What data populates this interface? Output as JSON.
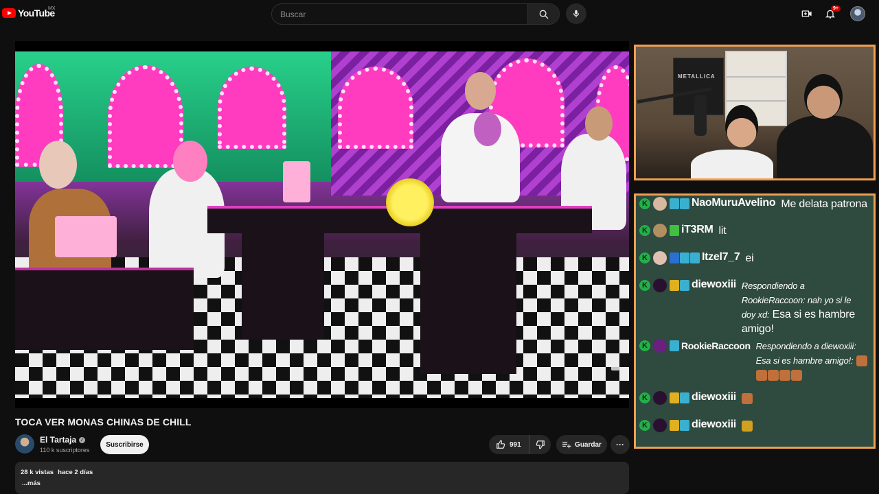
{
  "header": {
    "brand": "YouTube",
    "country": "MX",
    "search_placeholder": "Buscar",
    "notifications_count": "9+"
  },
  "video": {
    "title": "TOCA VER MONAS CHINAS DE CHILL"
  },
  "channel": {
    "name": "El Tartaja",
    "subscribers": "110 k suscriptores",
    "subscribe_label": "Suscribirse"
  },
  "actions": {
    "likes": "991",
    "save_label": "Guardar",
    "more_label": "···"
  },
  "description": {
    "views": "28 k vistas",
    "date": "hace 2 días",
    "more": "...más"
  },
  "webcam": {
    "poster_text": "METALLICA"
  },
  "chat": {
    "messages": [
      {
        "user": "NaoMuruAvelino",
        "text": "Me delata patrona"
      },
      {
        "user": "iT3RM",
        "text": "lit"
      },
      {
        "user": "Itzel7_7",
        "text": "ei"
      },
      {
        "user": "diewoxiii",
        "reply": "Respondiendo a RookieRaccoon: nah yo si le doy xd:",
        "text": "Esa si es hambre amigo!"
      },
      {
        "user": "RookieRaccoon",
        "reply": "Respondiendo a diewoxiii: Esa si es hambre amigo!:",
        "text": ""
      },
      {
        "user": "diewoxiii",
        "text": ""
      },
      {
        "user": "diewoxiii",
        "text": ""
      }
    ]
  },
  "colors": {
    "accent_red": "#ff0000",
    "frame_orange": "#f0a050",
    "chat_bg": "#2f4a3e",
    "badge_green": "#23b04a"
  }
}
